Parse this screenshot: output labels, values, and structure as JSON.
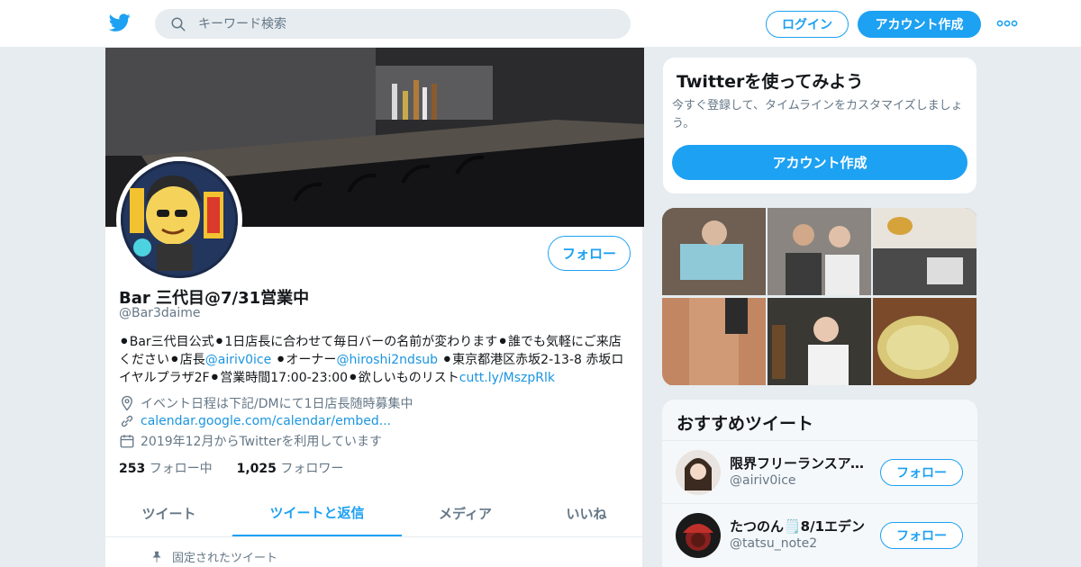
{
  "topbar": {
    "logo_icon": "twitter-bird-icon",
    "search_placeholder": "キーワード検索",
    "login_label": "ログイン",
    "signup_label": "アカウント作成",
    "more_icon": "more-dots-icon"
  },
  "profile": {
    "follow_label": "フォロー",
    "name": "Bar 三代目@7/31営業中",
    "handle": "@Bar3daime",
    "bio": {
      "t1": "⚫︎Bar三代目公式⚫︎1日店長に合わせて毎日バーの名前が変わります⚫誰でも気軽にご来店ください⚫店長",
      "link1": "@airiv0ice",
      "t2": " ⚫︎オーナー",
      "link2": "@hiroshi2ndsub",
      "t3": " ⚫︎東京都港区赤坂2-13-8 赤坂ロイヤルプラザ2F⚫︎営業時間17:00-23:00⚫︎欲しいものリスト",
      "link3": "cutt.ly/MszpRlk"
    },
    "location": "イベント日程は下記/DMにて1日店長随時募集中",
    "website": "calendar.google.com/calendar/embed...",
    "joined": "2019年12月からTwitterを利用しています",
    "following_count": "253",
    "following_label": "フォロー中",
    "followers_count": "1,025",
    "followers_label": "フォロワー",
    "tabs": [
      "ツイート",
      "ツイートと返信",
      "メディア",
      "いいね"
    ],
    "active_tab": "ツイートと返信",
    "pinned_label": "固定されたツイート"
  },
  "signup_card": {
    "title": "Twitterを使ってみよう",
    "text": "今すぐ登録して、タイムラインをカスタマイズしましょう。",
    "cta": "アカウント作成"
  },
  "recommended": {
    "title": "おすすめツイート",
    "items": [
      {
        "name": "限界フリーランスアイリ",
        "handle": "@airiv0ice",
        "follow": "フォロー"
      },
      {
        "name": "たつのん🗒️8/1エデン",
        "handle": "@tatsu_note2",
        "follow": "フォロー"
      }
    ]
  },
  "colors": {
    "accent": "#1da1f2",
    "link": "#1b95e0",
    "muted": "#657786",
    "background": "#e6ecf0"
  }
}
